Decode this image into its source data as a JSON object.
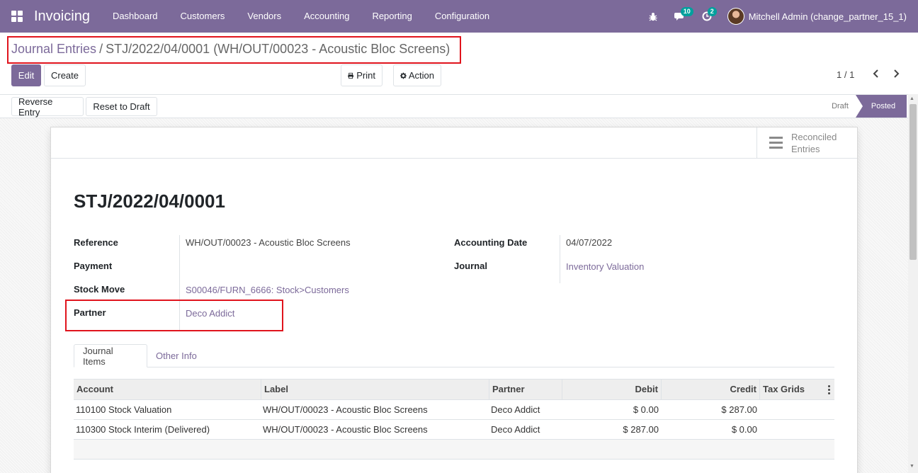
{
  "navbar": {
    "app_name": "Invoicing",
    "menu": [
      "Dashboard",
      "Customers",
      "Vendors",
      "Accounting",
      "Reporting",
      "Configuration"
    ],
    "messages_count": "10",
    "activities_count": "2",
    "user": "Mitchell Admin (change_partner_15_1)",
    "icons": [
      "apps-icon",
      "bug-icon",
      "chat-icon",
      "clock-icon",
      "avatar"
    ]
  },
  "breadcrumb": {
    "parent": "Journal Entries",
    "separator": "/",
    "current": "STJ/2022/04/0001 (WH/OUT/00023 - Acoustic Bloc Screens)"
  },
  "toolbar": {
    "edit": "Edit",
    "create": "Create",
    "print": "Print",
    "action": "Action",
    "pager": "1 / 1"
  },
  "statusbar": {
    "reverse_entry": "Reverse Entry",
    "reset_to_draft": "Reset to Draft",
    "stages": [
      "Draft",
      "Posted"
    ],
    "current_stage": "Posted"
  },
  "smart_button": {
    "line1": "Reconciled",
    "line2": "Entries"
  },
  "record": {
    "name": "STJ/2022/04/0001",
    "fields_left": [
      {
        "label": "Reference",
        "value": "WH/OUT/00023 - Acoustic Bloc Screens"
      },
      {
        "label": "Payment",
        "value": ""
      },
      {
        "label": "Stock Move",
        "value": "S00046/FURN_6666: Stock>Customers"
      },
      {
        "label": "Partner",
        "value": "Deco Addict"
      }
    ],
    "fields_right": [
      {
        "label": "Accounting Date",
        "value": "04/07/2022"
      },
      {
        "label": "Journal",
        "value": "Inventory Valuation"
      }
    ]
  },
  "tabs": [
    "Journal Items",
    "Other Info"
  ],
  "journal_items": {
    "columns": [
      "Account",
      "Label",
      "Partner",
      "Debit",
      "Credit",
      "Tax Grids"
    ],
    "rows": [
      {
        "account": "110100 Stock Valuation",
        "label": "WH/OUT/00023 - Acoustic Bloc Screens",
        "partner": "Deco Addict",
        "debit": "$ 0.00",
        "credit": "$ 287.00"
      },
      {
        "account": "110300 Stock Interim (Delivered)",
        "label": "WH/OUT/00023 - Acoustic Bloc Screens",
        "partner": "Deco Addict",
        "debit": "$ 287.00",
        "credit": "$ 0.00"
      }
    ]
  },
  "colors": {
    "brand": "#7c6a9a",
    "highlight": "#e0141d",
    "badge": "#00a09d"
  }
}
